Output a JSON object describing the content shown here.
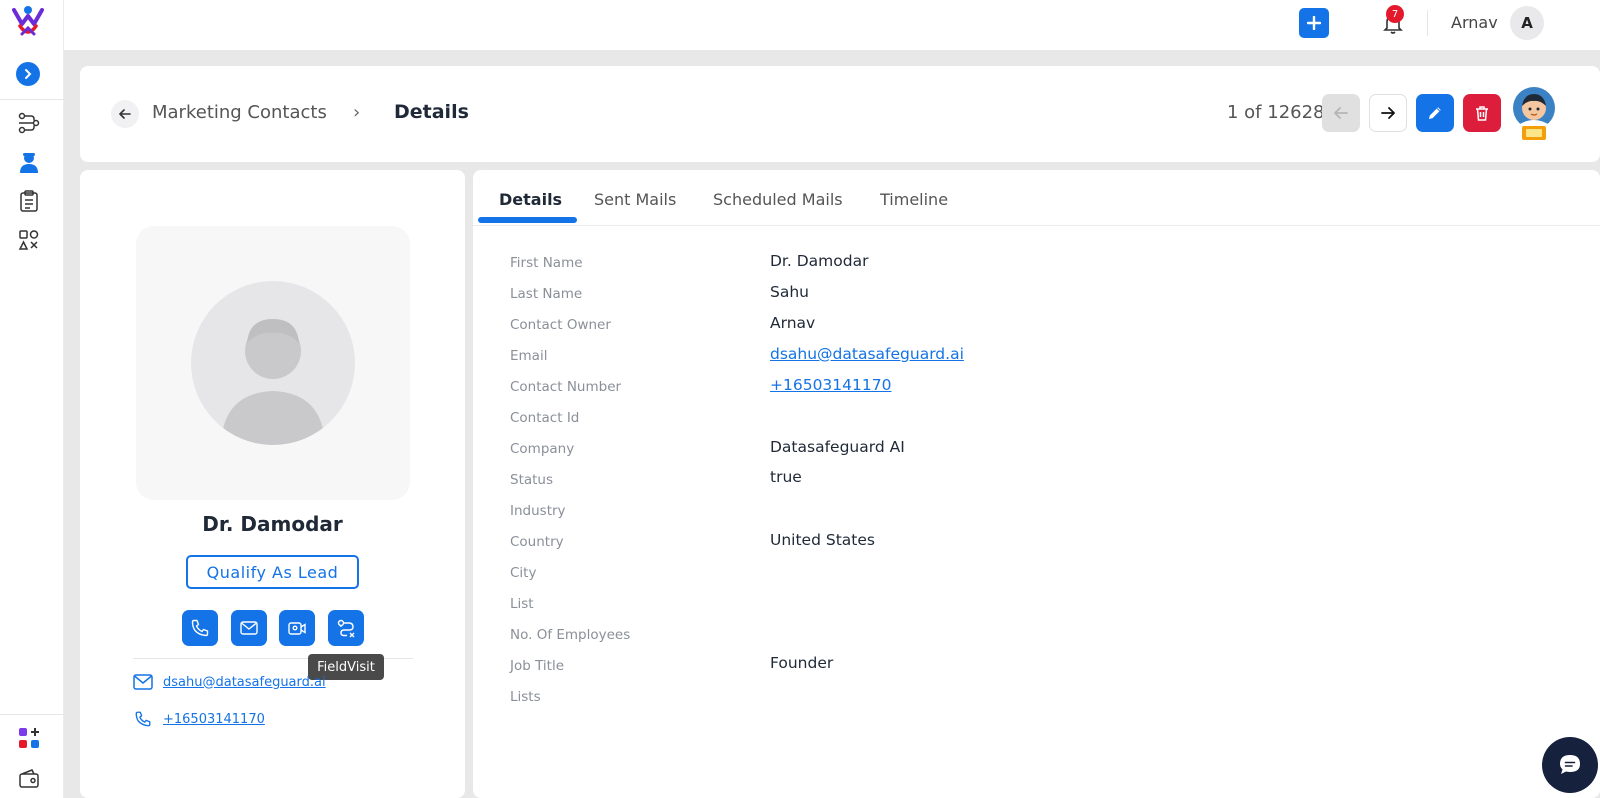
{
  "topbar": {
    "notification_count": "7",
    "user_name": "Arnav",
    "user_initial": "A"
  },
  "breadcrumb": {
    "parent": "Marketing Contacts",
    "separator": "›",
    "current": "Details"
  },
  "pager": {
    "text": "1 of 12628"
  },
  "profile": {
    "name": "Dr. Damodar",
    "qualify_label": "Qualify As Lead",
    "tooltip": "FieldVisit",
    "email": "dsahu@datasafeguard.ai",
    "phone": "+16503141170"
  },
  "tabs": [
    "Details",
    "Sent Mails",
    "Scheduled Mails",
    "Timeline"
  ],
  "fields": [
    {
      "label": "First Name",
      "value": "Dr. Damodar"
    },
    {
      "label": "Last Name",
      "value": "Sahu"
    },
    {
      "label": "Contact Owner",
      "value": "Arnav"
    },
    {
      "label": "Email",
      "value": "dsahu@datasafeguard.ai"
    },
    {
      "label": "Contact Number",
      "value": "+16503141170"
    },
    {
      "label": "Contact Id",
      "value": ""
    },
    {
      "label": "Company",
      "value": "Datasafeguard AI"
    },
    {
      "label": "Status",
      "value": "true"
    },
    {
      "label": "Industry",
      "value": ""
    },
    {
      "label": "Country",
      "value": "United States"
    },
    {
      "label": "City",
      "value": ""
    },
    {
      "label": "List",
      "value": ""
    },
    {
      "label": "No. Of Employees",
      "value": ""
    },
    {
      "label": "Job Title",
      "value": "Founder"
    },
    {
      "label": "Lists",
      "value": ""
    }
  ],
  "colors": {
    "accent": "#1473e6",
    "danger": "#dc1d3c",
    "badge": "#e5192c"
  },
  "icons": {
    "sidebar": [
      "logo-icon",
      "chevron-right-icon",
      "workflow-icon",
      "contacts-icon",
      "clipboard-icon",
      "shapes-icon",
      "apps-icon",
      "wallet-icon"
    ],
    "actions": [
      "phone-icon",
      "mail-icon",
      "video-call-icon",
      "field-visit-icon"
    ]
  }
}
